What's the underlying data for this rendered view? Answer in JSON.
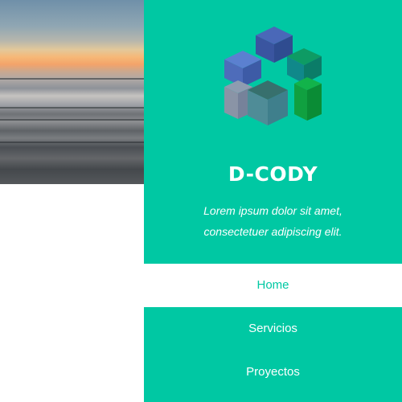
{
  "brand": {
    "title": "D-CODY",
    "tagline_line1": "Lorem ipsum dolor sit amet,",
    "tagline_line2": "consectetuer adipiscing elit.",
    "logo_icon": "cube-cluster-logo"
  },
  "hero": {
    "image_icon": "sunset-beach-photo"
  },
  "colors": {
    "accent": "#00c8a3",
    "text_on_accent": "#ffffff"
  },
  "nav": {
    "items": [
      {
        "label": "Home",
        "active": true
      },
      {
        "label": "Servicios",
        "active": false
      },
      {
        "label": "Proyectos",
        "active": false
      }
    ]
  }
}
